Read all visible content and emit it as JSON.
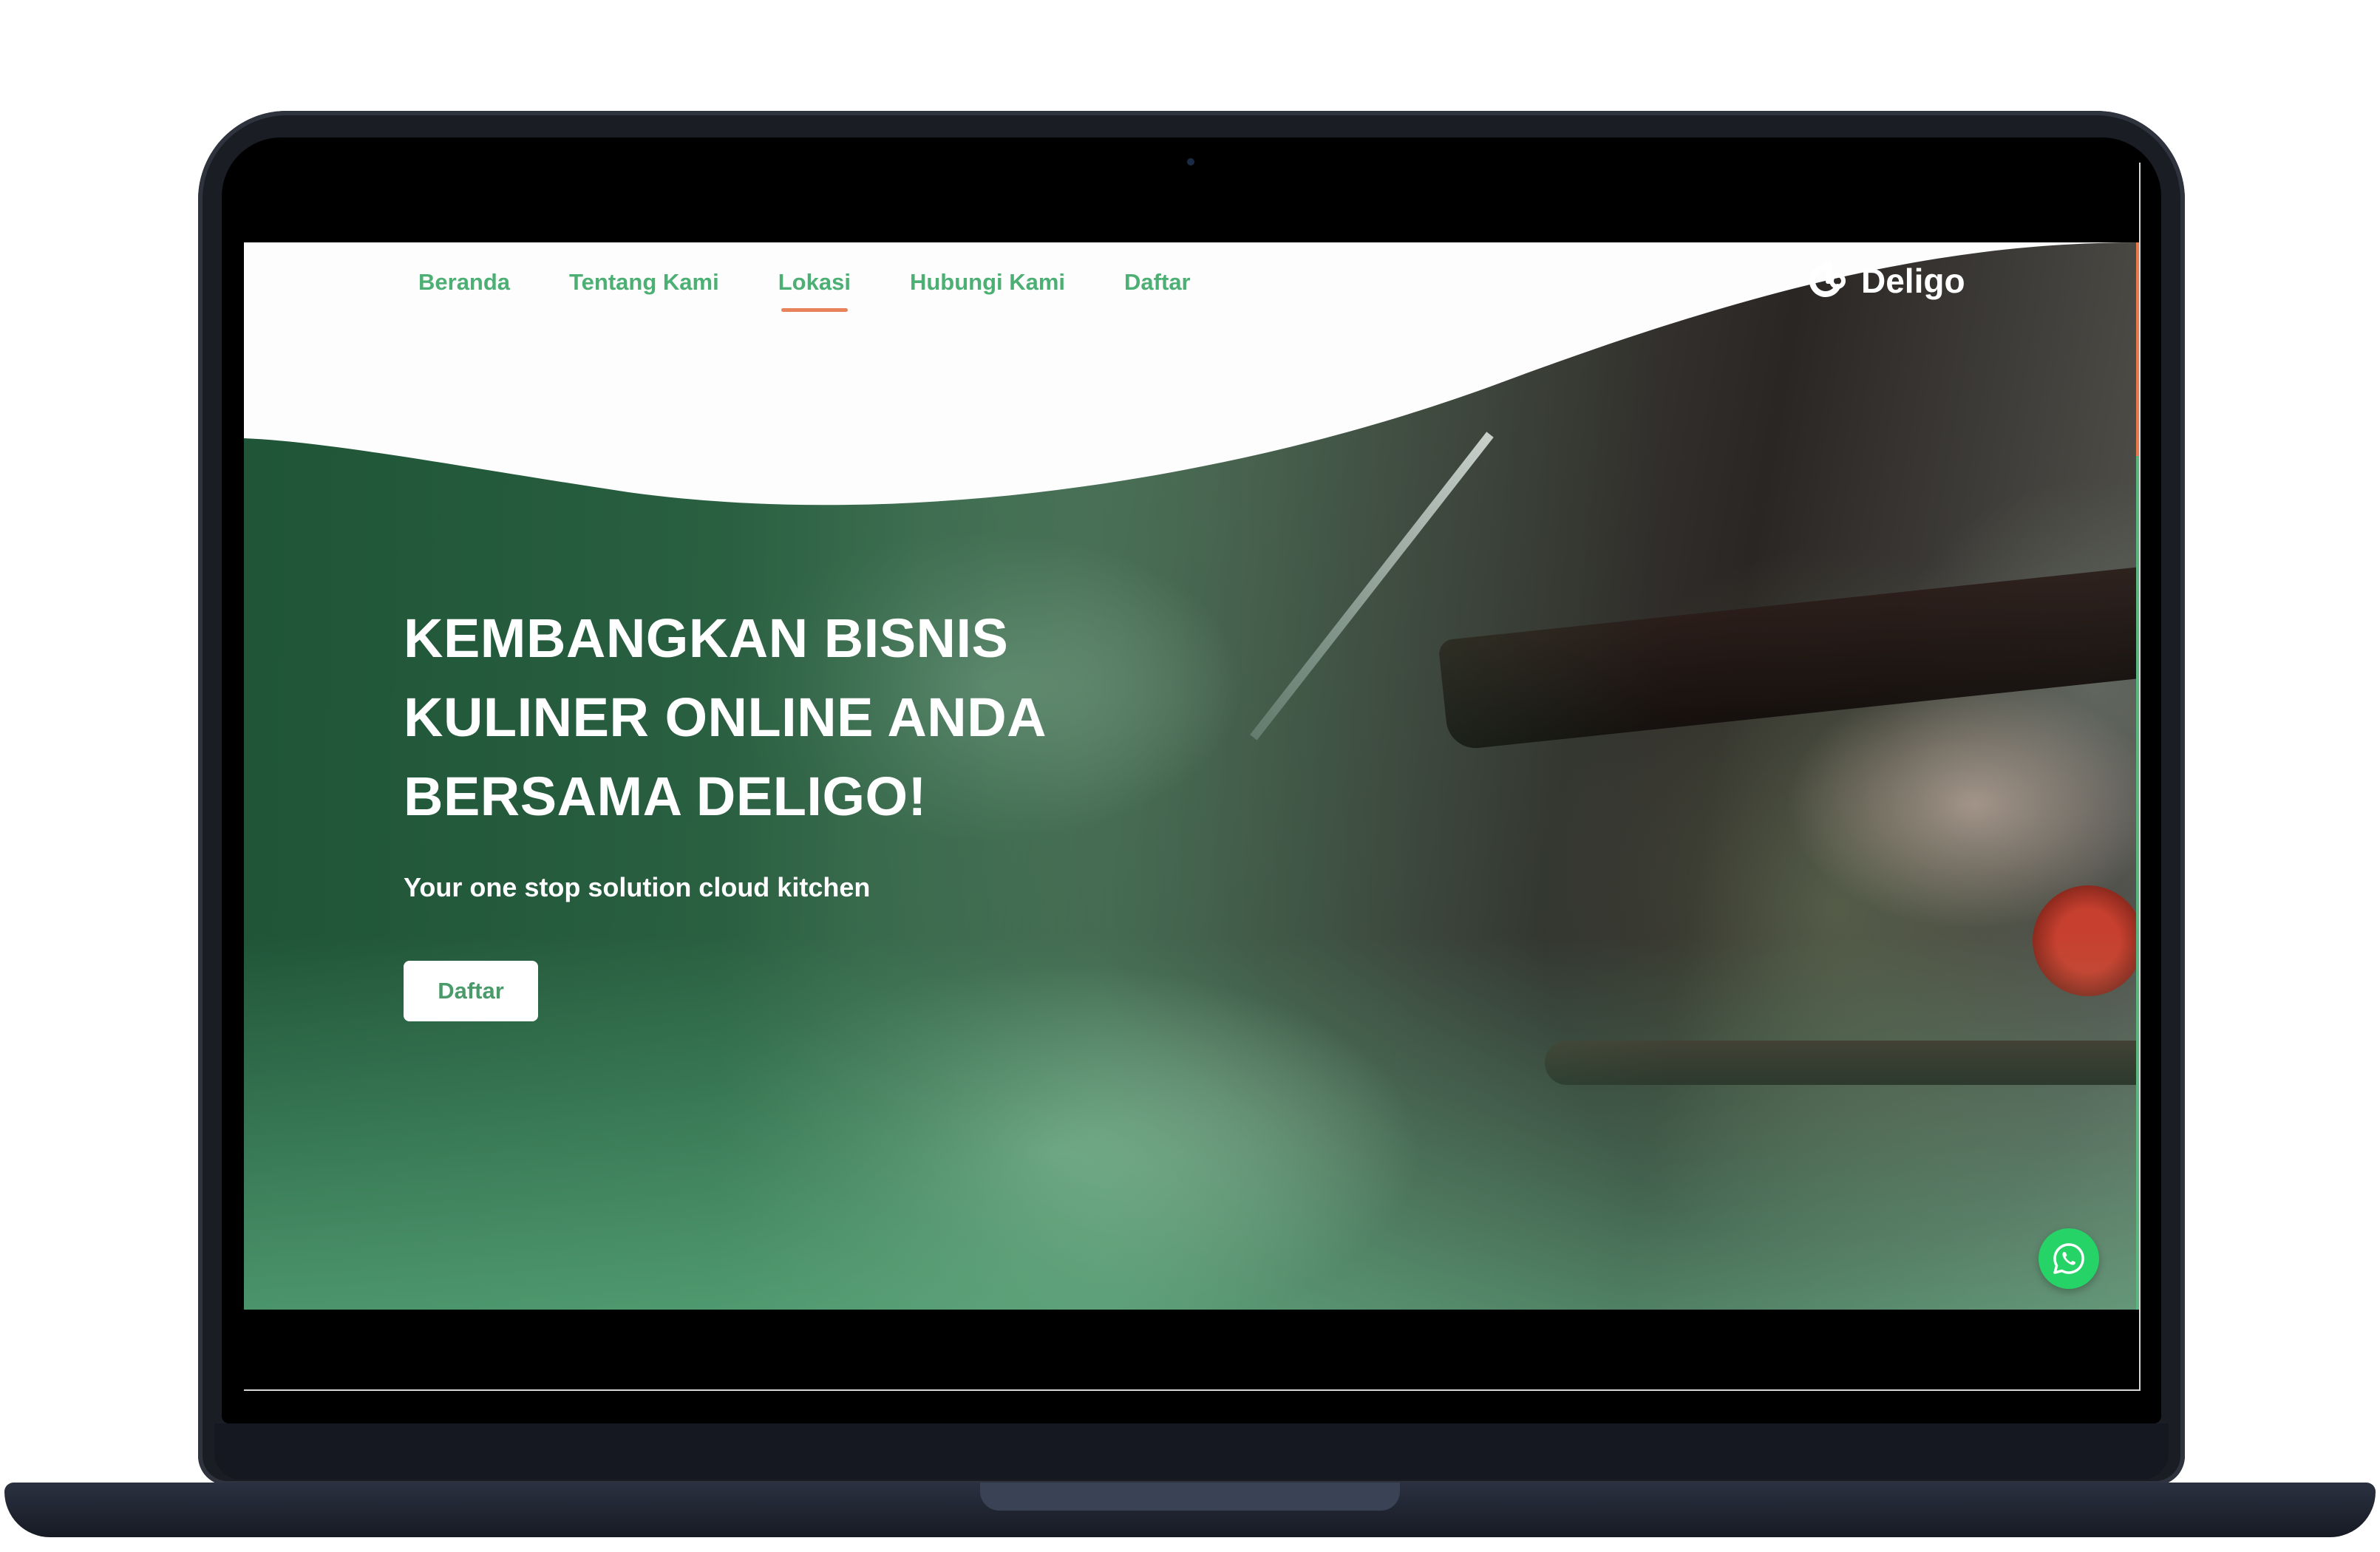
{
  "nav": {
    "items": [
      {
        "label": "Beranda"
      },
      {
        "label": "Tentang Kami"
      },
      {
        "label": "Lokasi"
      },
      {
        "label": "Hubungi Kami"
      },
      {
        "label": "Daftar"
      }
    ],
    "active": "Lokasi"
  },
  "brand": {
    "name": "Deligo"
  },
  "hero": {
    "title_line1": "KEMBANGKAN BISNIS",
    "title_line2": "KULINER ONLINE ANDA",
    "title_line3": "BERSAMA DELIGO!",
    "subtitle": "Your one stop solution cloud kitchen",
    "button_label": "Daftar"
  },
  "icons": {
    "brand": "deligo-logo-icon",
    "chat": "whatsapp-icon"
  },
  "colors": {
    "accent_green": "#4caf73",
    "active_underline": "#e8825a",
    "whatsapp": "#25d366"
  }
}
